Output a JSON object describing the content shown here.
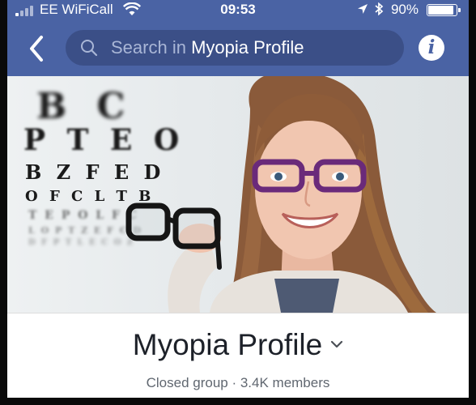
{
  "status_bar": {
    "carrier": "EE WiFiCall",
    "time": "09:53",
    "battery": "90%",
    "battery_level": 0.9
  },
  "nav": {
    "search_prefix": "Search in ",
    "search_group": "Myopia Profile"
  },
  "cover": {
    "chart_rows": [
      "B C",
      "P T E O",
      "B Z F E D",
      "O F C L T B",
      "T E P O L F C",
      "L O P T Z E F C D",
      "D F P T L E C O Z"
    ]
  },
  "group": {
    "name": "Myopia Profile",
    "meta": "Closed group · 3.4K members"
  },
  "colors": {
    "nav_bg": "#4a63a4",
    "search_bg": "#3b4f87",
    "title_text": "#1d2129",
    "meta_text": "#606770"
  },
  "icons": {
    "back": "chevron-left-icon",
    "search": "magnifier-icon",
    "info": "info-circle-icon",
    "caret": "chevron-down-icon"
  }
}
